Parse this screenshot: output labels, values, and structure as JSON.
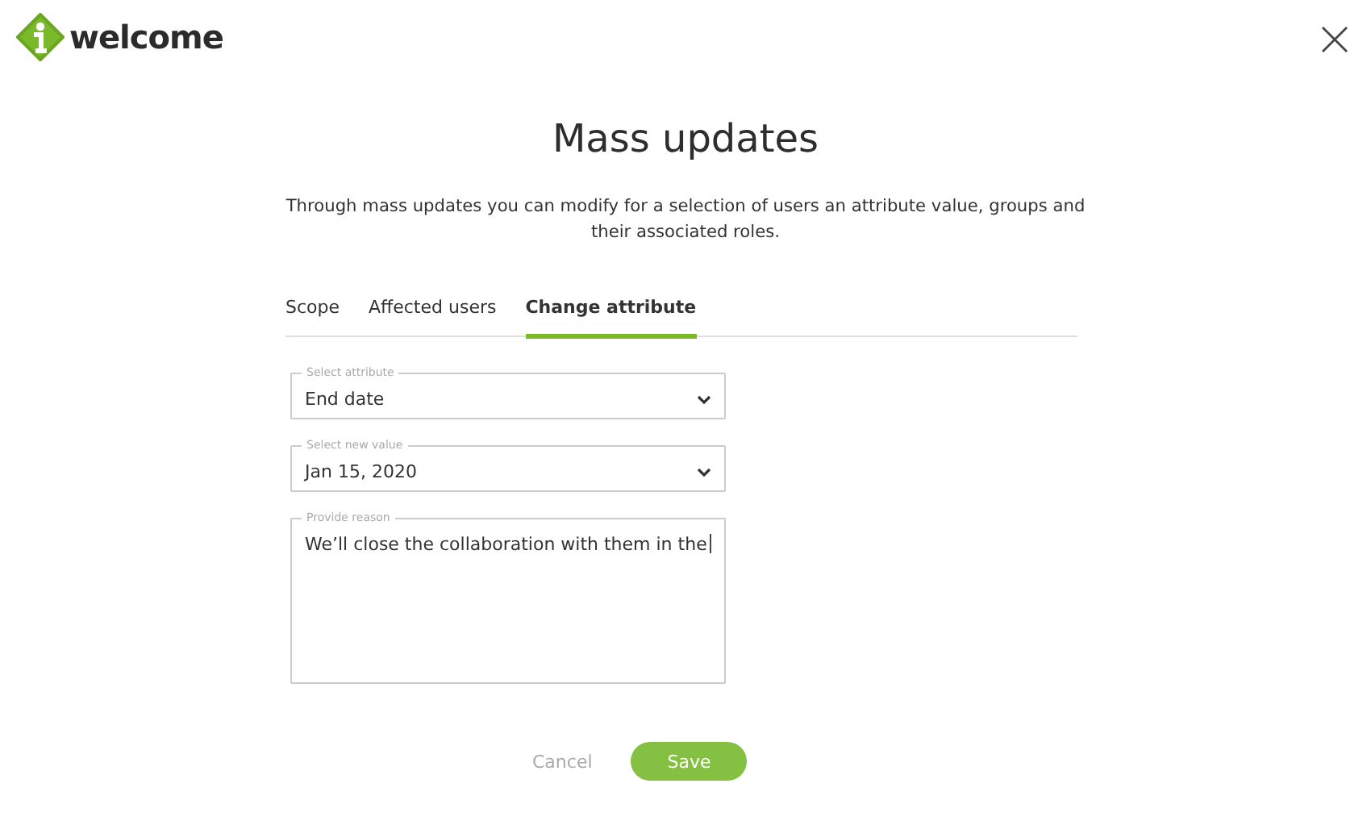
{
  "header": {
    "logo_text": "welcome"
  },
  "dialog": {
    "title": "Mass updates",
    "description": "Through mass updates you can modify for a selection of users an attribute value, groups and their associated roles.",
    "tabs": [
      {
        "label": "Scope",
        "selected": false
      },
      {
        "label": "Affected users",
        "selected": false
      },
      {
        "label": "Change attribute",
        "selected": true
      }
    ],
    "fields": [
      {
        "kind": "select",
        "label": "Select attribute",
        "value": "End date"
      },
      {
        "kind": "select",
        "label": "Select new value",
        "value": "Jan 15, 2020"
      },
      {
        "kind": "textarea",
        "label": "Provide reason",
        "value": "We’ll close the collaboration with them in the ",
        "focused": true
      }
    ],
    "buttons": [
      {
        "kind": "secondary",
        "label": "Cancel"
      },
      {
        "kind": "primary",
        "label": "Save"
      }
    ]
  }
}
